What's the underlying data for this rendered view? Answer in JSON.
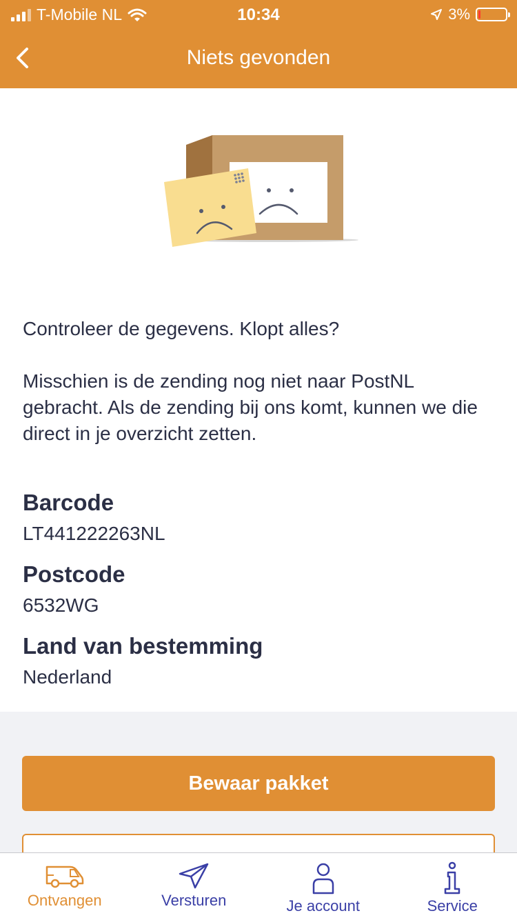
{
  "status_bar": {
    "carrier": "T-Mobile NL",
    "time": "10:34",
    "battery": "3%"
  },
  "nav": {
    "title": "Niets gevonden",
    "back_icon": "chevron-left-icon"
  },
  "messages": {
    "check": "Controleer de gegevens. Klopt alles?",
    "explanation": "Misschien is de zending nog niet naar PostNL gebracht. Als de zending bij ons komt, kunnen we die direct in je overzicht zetten."
  },
  "details": {
    "barcode_label": "Barcode",
    "barcode_value": "LT441222263NL",
    "postcode_label": "Postcode",
    "postcode_value": "6532WG",
    "country_label": "Land van bestemming",
    "country_value": "Nederland"
  },
  "actions": {
    "save_label": "Bewaar pakket"
  },
  "tabs": [
    {
      "label": "Ontvangen",
      "icon": "van-icon",
      "active": true
    },
    {
      "label": "Versturen",
      "icon": "send-icon",
      "active": false
    },
    {
      "label": "Je account",
      "icon": "user-icon",
      "active": false
    },
    {
      "label": "Service",
      "icon": "info-icon",
      "active": false
    }
  ],
  "colors": {
    "accent": "#e08f34",
    "text": "#2b2f45",
    "tab_inactive": "#3a3fa6",
    "background_gray": "#f1f2f5"
  }
}
